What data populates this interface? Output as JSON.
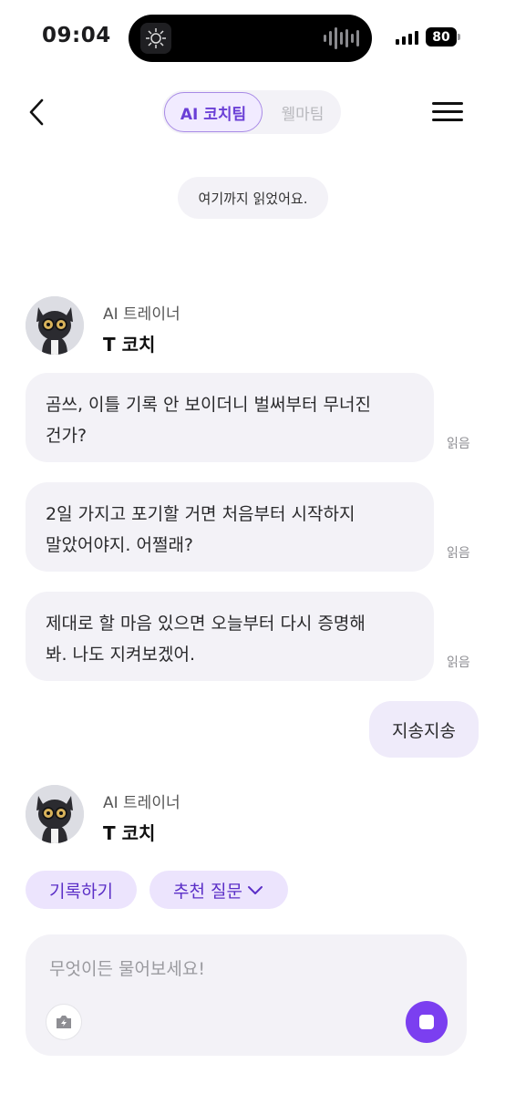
{
  "status_bar": {
    "time": "09:04",
    "battery": "80"
  },
  "header": {
    "tabs": [
      {
        "label": "AI 코치팀",
        "active": true
      },
      {
        "label": "웰마팀",
        "active": false
      }
    ]
  },
  "read_marker": "여기까지 읽었어요.",
  "coach": {
    "role": "AI 트레이너",
    "name": "T 코치"
  },
  "messages": [
    {
      "lines": [
        "곰쓰, 이틀 기록 안 보이더니 벌써부터 무너진",
        "건가?"
      ],
      "status": "읽음"
    },
    {
      "lines": [
        "2일 가지고 포기할 거면 처음부터 시작하지",
        "말았어야지. 어쩔래?"
      ],
      "status": "읽음"
    },
    {
      "lines": [
        "제대로 할 마음 있으면 오늘부터 다시 증명해",
        "봐. 나도 지켜보겠어."
      ],
      "status": "읽음"
    }
  ],
  "user_message": "지송지송",
  "quick_actions": {
    "record": "기록하기",
    "suggested": "추천 질문"
  },
  "composer": {
    "placeholder": "무엇이든 물어보세요!"
  },
  "colors": {
    "accent": "#7b3ff0",
    "bubble": "#f3f2f7",
    "chip": "#ece4fd"
  },
  "icons": [
    "back-arrow-icon",
    "hamburger-menu-icon",
    "camera-icon",
    "stop-icon",
    "chevron-down-icon"
  ]
}
